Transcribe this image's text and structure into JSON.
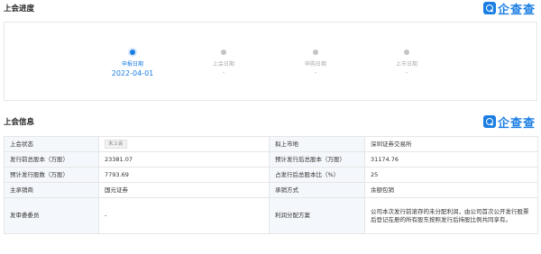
{
  "progress_section": {
    "title": "上会进度",
    "brand": "企查查",
    "steps": [
      {
        "label": "申报日期",
        "date": "2022-04-01"
      },
      {
        "label": "上会日期",
        "date": "-"
      },
      {
        "label": "申购日期",
        "date": "-"
      },
      {
        "label": "上市日期",
        "date": "-"
      }
    ]
  },
  "info_section": {
    "title": "上会信息",
    "brand": "企查查",
    "rows": [
      {
        "l1": "上会状态",
        "v1": "未上会",
        "l2": "拟上市地",
        "v2": "深圳证券交易所"
      },
      {
        "l1": "发行前总股本（万股）",
        "v1": "23381.07",
        "l2": "预计发行后总股本（万股）",
        "v2": "31174.76"
      },
      {
        "l1": "预计发行股数（万股）",
        "v1": "7793.69",
        "l2": "占发行后总股本比（%）",
        "v2": "25"
      },
      {
        "l1": "主承销商",
        "v1": "国元证券",
        "l2": "承销方式",
        "v2": "余额包销"
      },
      {
        "l1": "发审委委员",
        "v1": "-",
        "l2": "利润分配方案",
        "v2": "公司本次发行前滚存的未分配利润，由公司首次公开发行股票后登记在册的所有股东按照发行后持股比例共同享有。"
      }
    ]
  }
}
